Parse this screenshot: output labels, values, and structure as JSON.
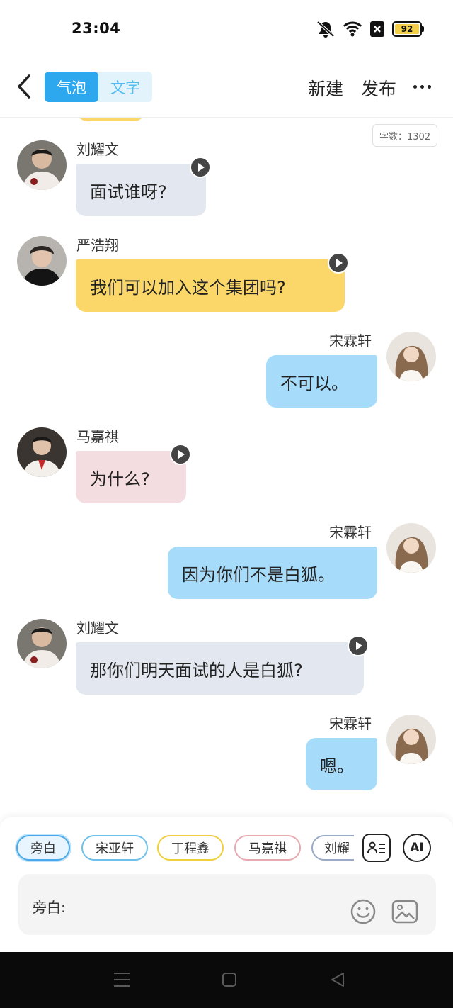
{
  "status_bar": {
    "time": "23:04",
    "battery": "92",
    "icons": [
      "mute-icon",
      "wifi-icon",
      "sim-off-icon",
      "battery-icon"
    ]
  },
  "header": {
    "mode_tabs": [
      {
        "label": "气泡",
        "active": true
      },
      {
        "label": "文字",
        "active": false
      }
    ],
    "new_label": "新建",
    "publish_label": "发布",
    "icons": [
      "back-icon",
      "more-icon"
    ]
  },
  "word_count": "字数：1302",
  "messages": [
    {
      "sender": "刘耀文",
      "side": "left",
      "text": "面试谁呀?",
      "bubble_color": "#e3e8f0",
      "has_voice": true
    },
    {
      "sender": "严浩翔",
      "side": "left",
      "text": "我们可以加入这个集团吗?",
      "bubble_color": "#fbd669",
      "has_voice": true
    },
    {
      "sender": "宋霖轩",
      "side": "right",
      "text": "不可以。",
      "bubble_color": "#a6dbfa",
      "has_voice": false
    },
    {
      "sender": "马嘉祺",
      "side": "left",
      "text": "为什么?",
      "bubble_color": "#f4dde0",
      "has_voice": true
    },
    {
      "sender": "宋霖轩",
      "side": "right",
      "text": "因为你们不是白狐。",
      "bubble_color": "#a6dbfa",
      "has_voice": false
    },
    {
      "sender": "刘耀文",
      "side": "left",
      "text": "那你们明天面试的人是白狐?",
      "bubble_color": "#e3e8f0",
      "has_voice": true
    },
    {
      "sender": "宋霖轩",
      "side": "right",
      "text": "嗯。",
      "bubble_color": "#a6dbfa",
      "has_voice": false
    }
  ],
  "role_chips": [
    {
      "label": "旁白",
      "color": "#4aa9e8",
      "selected": true
    },
    {
      "label": "宋亚轩",
      "color": "#6cc0ea",
      "selected": false
    },
    {
      "label": "丁程鑫",
      "color": "#f0cf3c",
      "selected": false
    },
    {
      "label": "马嘉祺",
      "color": "#e7a9b0",
      "selected": false
    },
    {
      "label": "刘耀",
      "color": "#9aa9c7",
      "selected": false
    }
  ],
  "tools": {
    "ai_label": "AI",
    "icons": [
      "contact-card-icon",
      "emoji-icon",
      "image-icon"
    ]
  },
  "input": {
    "label": "旁白:",
    "value": ""
  },
  "navbar": {
    "icons": [
      "menu-icon",
      "home-icon",
      "back-triangle-icon"
    ]
  }
}
